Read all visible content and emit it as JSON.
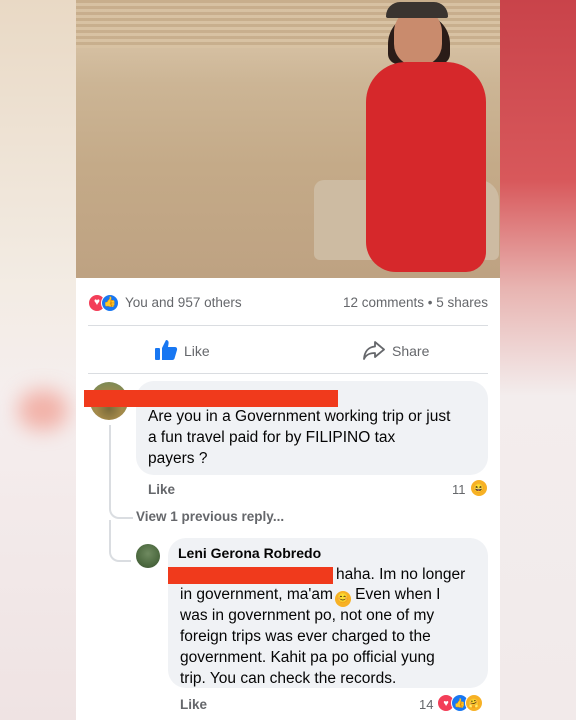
{
  "post": {
    "reactions_summary": "You and 957 others",
    "comments_shares": "12 comments • 5 shares",
    "actions": {
      "like": "Like",
      "share": "Share"
    }
  },
  "comment1": {
    "text_line1": "Are you in a Government working trip or just",
    "text_line2": "a fun travel paid for by FILIPINO tax",
    "text_line3": "payers ?",
    "like_label": "Like",
    "reaction_count": "11",
    "reaction_icon": "haha-emoji-icon"
  },
  "view_previous": "View 1 previous reply...",
  "reply": {
    "author": "Leni Gerona Robredo",
    "line1": "haha. Im no longer",
    "line2a": "in government, ma'am",
    "line2b": " Even when I",
    "line3": "was in government po, not one of my",
    "line4": "foreign trips was ever charged to the",
    "line5": "government. Kahit pa po official yung",
    "line6": "trip. You can check the records.",
    "like_label": "Like",
    "reaction_count": "14",
    "reaction_icons": [
      "heart-icon",
      "like-icon",
      "care-emoji-icon"
    ]
  },
  "colors": {
    "facebook_blue": "#1877f2",
    "heart_red": "#f33e58",
    "redaction_red": "#f03a1c",
    "bubble_gray": "#f0f2f5"
  }
}
